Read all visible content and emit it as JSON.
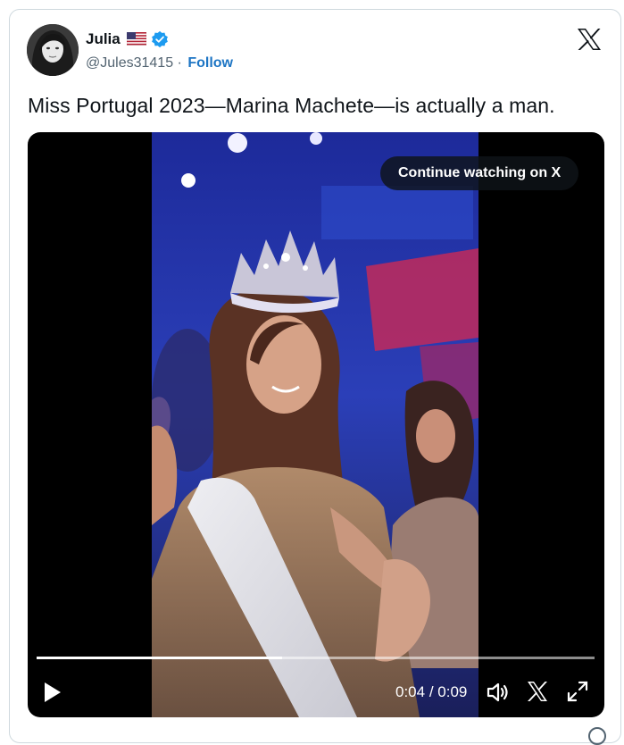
{
  "user": {
    "name": "Julia",
    "flag_icon": "us-flag-icon",
    "verified_icon": "verified-badge-icon",
    "handle": "@Jules31415",
    "separator": "·",
    "follow_label": "Follow"
  },
  "header": {
    "brand_icon": "x-logo-icon"
  },
  "tweet": {
    "text": "Miss Portugal 2023—Marina Machete—is actually a man."
  },
  "video": {
    "continue_label": "Continue watching on X",
    "current_time": "0:04",
    "duration": "0:09",
    "time_separator": "/",
    "progress": 0.44,
    "controls": [
      "play-icon",
      "volume-icon",
      "x-logo-icon",
      "fullscreen-icon"
    ]
  },
  "colors": {
    "follow": "#1d75c4",
    "verified": "#1d9bf0",
    "muted_text": "#536471",
    "border": "#cfd9de"
  }
}
